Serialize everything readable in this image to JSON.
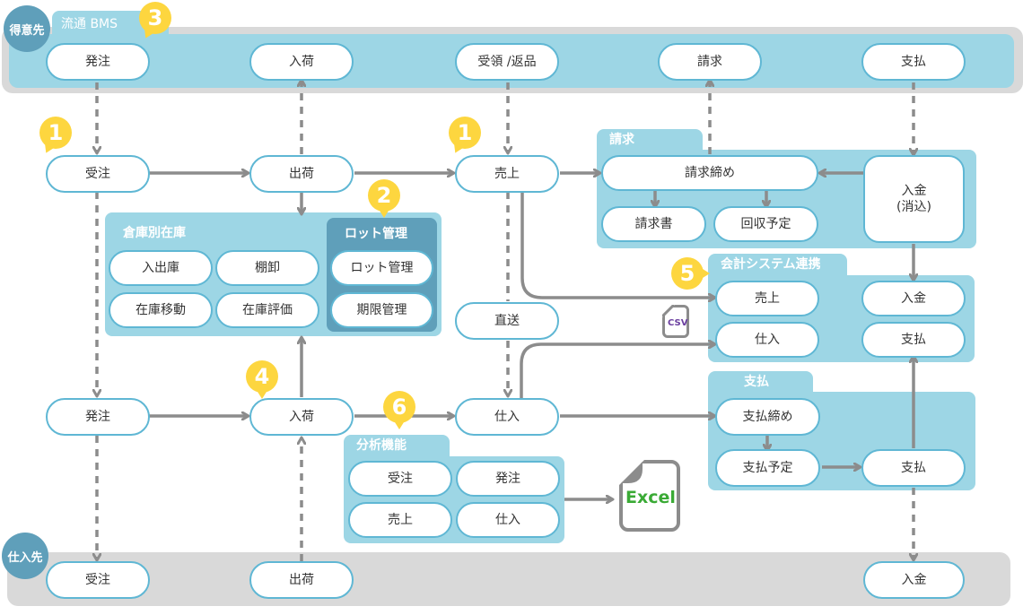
{
  "parties": {
    "customer": "得意先",
    "supplier": "仕入先"
  },
  "bms_label": "流通 BMS",
  "badges": [
    "1",
    "1",
    "2",
    "3",
    "4",
    "5",
    "6"
  ],
  "customer_band": {
    "nodes": [
      "発注",
      "入荷",
      "受領 /返品",
      "請求",
      "支払"
    ]
  },
  "supplier_band": {
    "nodes": [
      "受注",
      "出荷",
      "入金"
    ]
  },
  "flow": {
    "order_received": "受注",
    "shipping": "出荷",
    "sales": "売上",
    "direct_ship": "直送",
    "purchase_order": "発注",
    "receiving": "入荷",
    "purchase": "仕入"
  },
  "inventory_panel": {
    "title": "倉庫別在庫",
    "items": [
      "入出庫",
      "棚卸",
      "在庫移動",
      "在庫評価"
    ]
  },
  "lot_panel": {
    "title": "ロット管理",
    "items": [
      "ロット管理",
      "期限管理"
    ]
  },
  "billing_panel": {
    "title": "請求",
    "closing": "請求締め",
    "invoice": "請求書",
    "collection_plan": "回収予定",
    "payment_received": "入金\n(消込)"
  },
  "accounting_panel": {
    "title": "会計システム連携",
    "items": [
      "売上",
      "仕入",
      "入金",
      "支払"
    ]
  },
  "payment_panel": {
    "title": "支払",
    "closing": "支払締め",
    "schedule": "支払予定",
    "payment": "支払"
  },
  "analysis_panel": {
    "title": "分析機能",
    "items": [
      "受注",
      "発注",
      "売上",
      "仕入"
    ]
  },
  "files": {
    "csv": "CSV",
    "excel": "Excel"
  },
  "colors": {
    "band_blue": "#9dd6e5",
    "band_gray": "#d9d9d9",
    "party_circle": "#5f9fba",
    "badge_yellow": "#fdd63f",
    "node_border": "#5fb7d4",
    "arrow": "#8c8c8c",
    "csv_text": "#6b3fa0",
    "excel_text": "#3aaa35"
  }
}
